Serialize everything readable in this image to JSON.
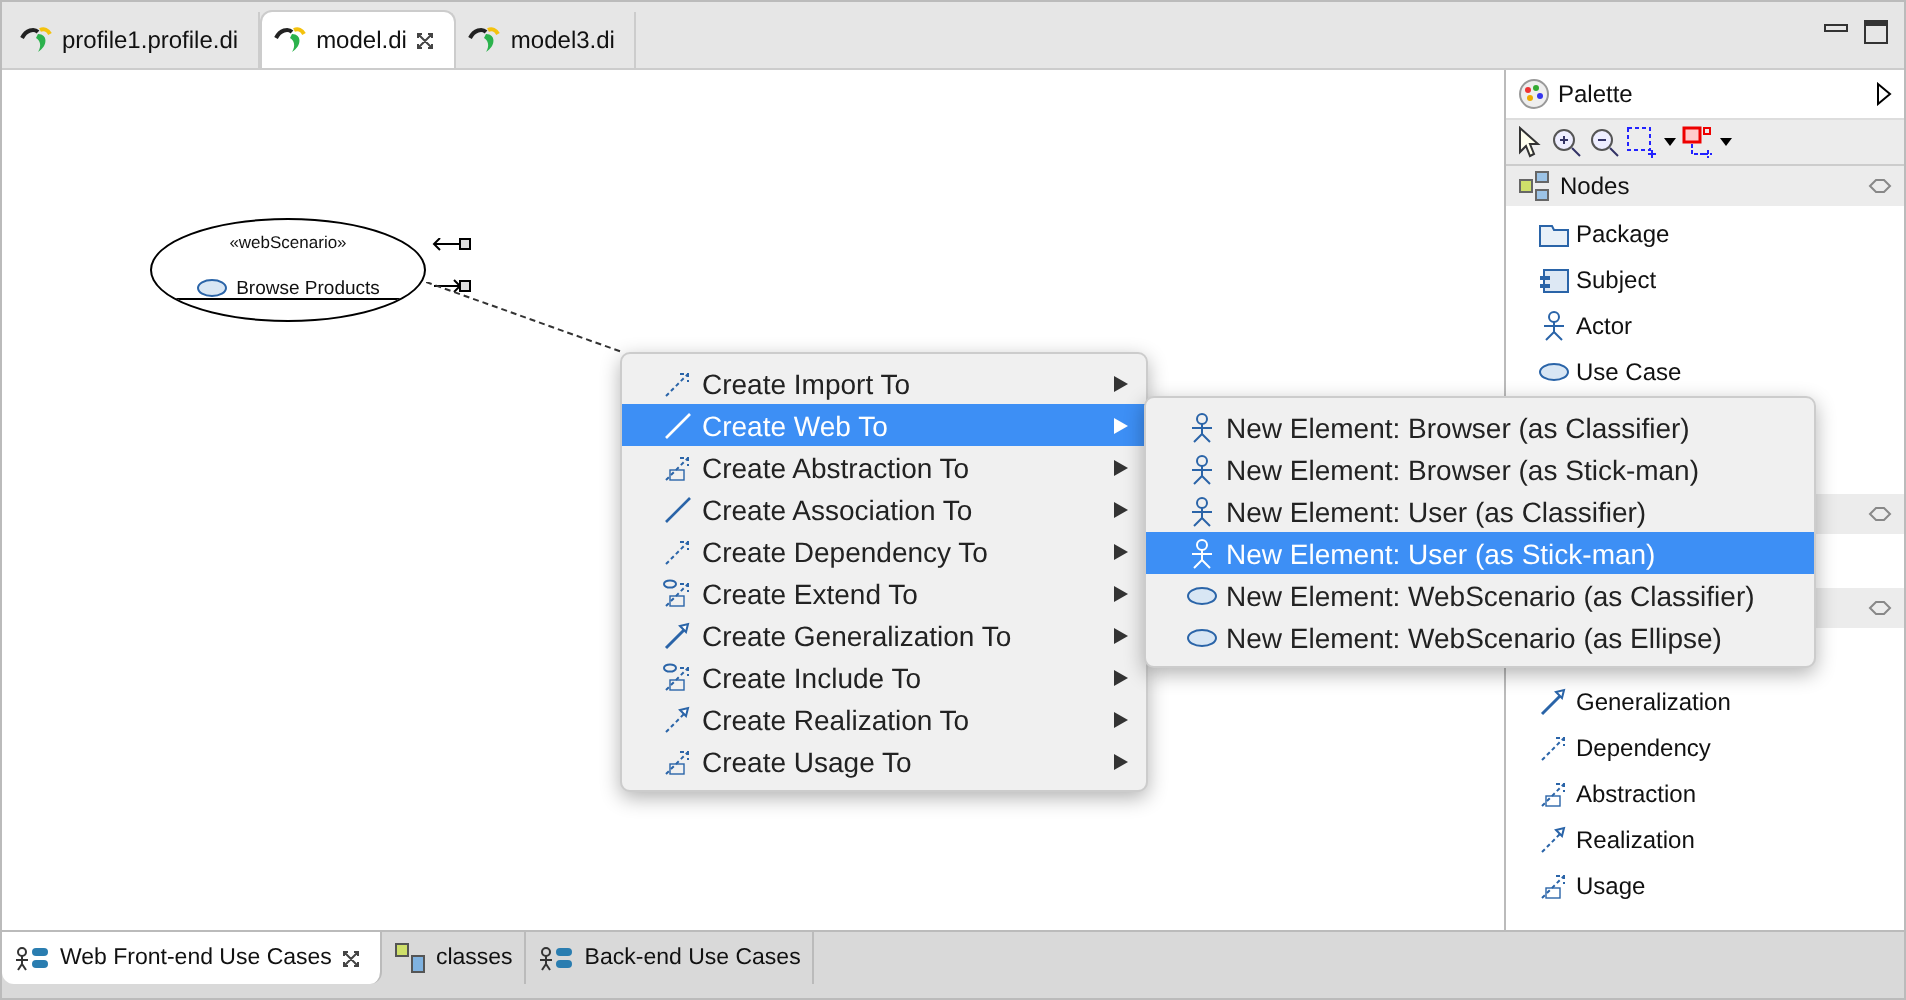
{
  "editor_tabs": [
    {
      "label": "profile1.profile.di",
      "selected": false
    },
    {
      "label": "model.di",
      "selected": true
    },
    {
      "label": "model3.di",
      "selected": false
    }
  ],
  "diagram": {
    "stereotype": "«webScenario»",
    "name": "Browse Products"
  },
  "palette": {
    "title": "Palette",
    "sections": [
      {
        "title": "Nodes",
        "items": [
          {
            "label": "Package",
            "kind": "package"
          },
          {
            "label": "Subject",
            "kind": "subject"
          },
          {
            "label": "Actor",
            "kind": "actor"
          },
          {
            "label": "Use Case",
            "kind": "usecase"
          }
        ]
      },
      {
        "items": [
          {
            "label": "Generalization",
            "kind": "generalization"
          },
          {
            "label": "Dependency",
            "kind": "dependency"
          },
          {
            "label": "Abstraction",
            "kind": "abstraction"
          },
          {
            "label": "Realization",
            "kind": "realization"
          },
          {
            "label": "Usage",
            "kind": "usage"
          }
        ]
      }
    ]
  },
  "context_menu": [
    {
      "label": "Create Import To",
      "kind": "dependency",
      "selected": false
    },
    {
      "label": "Create Web To",
      "kind": "association",
      "selected": true
    },
    {
      "label": "Create Abstraction To",
      "kind": "abstraction",
      "selected": false
    },
    {
      "label": "Create Association To",
      "kind": "association",
      "selected": false
    },
    {
      "label": "Create Dependency To",
      "kind": "dependency",
      "selected": false
    },
    {
      "label": "Create Extend To",
      "kind": "extend",
      "selected": false
    },
    {
      "label": "Create Generalization To",
      "kind": "generalization",
      "selected": false
    },
    {
      "label": "Create Include To",
      "kind": "include",
      "selected": false
    },
    {
      "label": "Create Realization To",
      "kind": "realization",
      "selected": false
    },
    {
      "label": "Create Usage To",
      "kind": "usage",
      "selected": false
    }
  ],
  "submenu": [
    {
      "label": "New Element: Browser (as Classifier)",
      "kind": "actor",
      "selected": false
    },
    {
      "label": "New Element: Browser (as Stick-man)",
      "kind": "actor",
      "selected": false
    },
    {
      "label": "New Element: User (as Classifier)",
      "kind": "actor",
      "selected": false
    },
    {
      "label": "New Element: User (as Stick-man)",
      "kind": "actor",
      "selected": true
    },
    {
      "label": "New Element: WebScenario (as Classifier)",
      "kind": "usecase",
      "selected": false
    },
    {
      "label": "New Element: WebScenario (as Ellipse)",
      "kind": "usecase",
      "selected": false
    }
  ],
  "diagram_tabs": [
    {
      "label": "Web Front-end Use Cases",
      "kind": "usecase",
      "selected": true
    },
    {
      "label": "classes",
      "kind": "class",
      "selected": false
    },
    {
      "label": "Back-end Use Cases",
      "kind": "usecase",
      "selected": false
    }
  ]
}
